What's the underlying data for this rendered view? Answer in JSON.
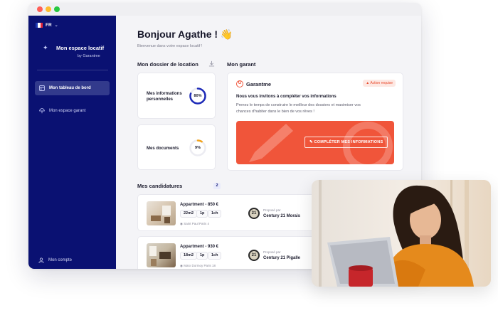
{
  "sidebar": {
    "lang": "FR",
    "brand_title": "Mon espace locatif",
    "brand_sub": "by Garantme",
    "nav": [
      {
        "label": "Mon tableau de bord",
        "icon": "dashboard-icon"
      },
      {
        "label": "Mon espace garant",
        "icon": "umbrella-icon"
      }
    ],
    "account": "Mon compte"
  },
  "main": {
    "greeting": "Bonjour Agathe ! 👋",
    "welcome": "Bienvenue dans votre espace locatif !",
    "dossier_title": "Mon dossier de location",
    "garant_title": "Mon garant",
    "docs": [
      {
        "label_line1": "Mes informations",
        "label_line2": "personnelles",
        "percent": 80,
        "percent_label": "80%"
      },
      {
        "label_line1": "Mes documents",
        "label_line2": "",
        "percent": 9,
        "percent_label": "9%"
      }
    ],
    "garant": {
      "name": "Garantme",
      "badge": "Action requise",
      "invite": "Nous vous invitons à compléter vos informations",
      "desc": "Prenez le temps de construire le meilleur des dossiers et maximiser vos chances d'habiter dans le bien de vos rêves !",
      "cta": "COMPLÉTER MES INFORMATIONS"
    },
    "candidatures_title": "Mes candidatures",
    "candidatures_count": "2",
    "applications": [
      {
        "title": "Appartment - 850 €",
        "tags": [
          "22m2",
          "1p",
          "1ch"
        ],
        "address": "Saint Paul Paris 4",
        "proposed": "Proposé par",
        "agency": "Century 21 Morais",
        "agency_logo": "21"
      },
      {
        "title": "Appartment - 930 €",
        "tags": [
          "18m2",
          "1p",
          "1ch"
        ],
        "address": "Marx Dormoy Paris 18",
        "proposed": "Proposé par",
        "agency": "Century 21 Pigalle",
        "agency_logo": "21"
      }
    ]
  },
  "colors": {
    "sidebar": "#0a1172",
    "accent": "#f0553a",
    "ring_info": "#1e2bb8",
    "ring_docs": "#f2a31b"
  }
}
